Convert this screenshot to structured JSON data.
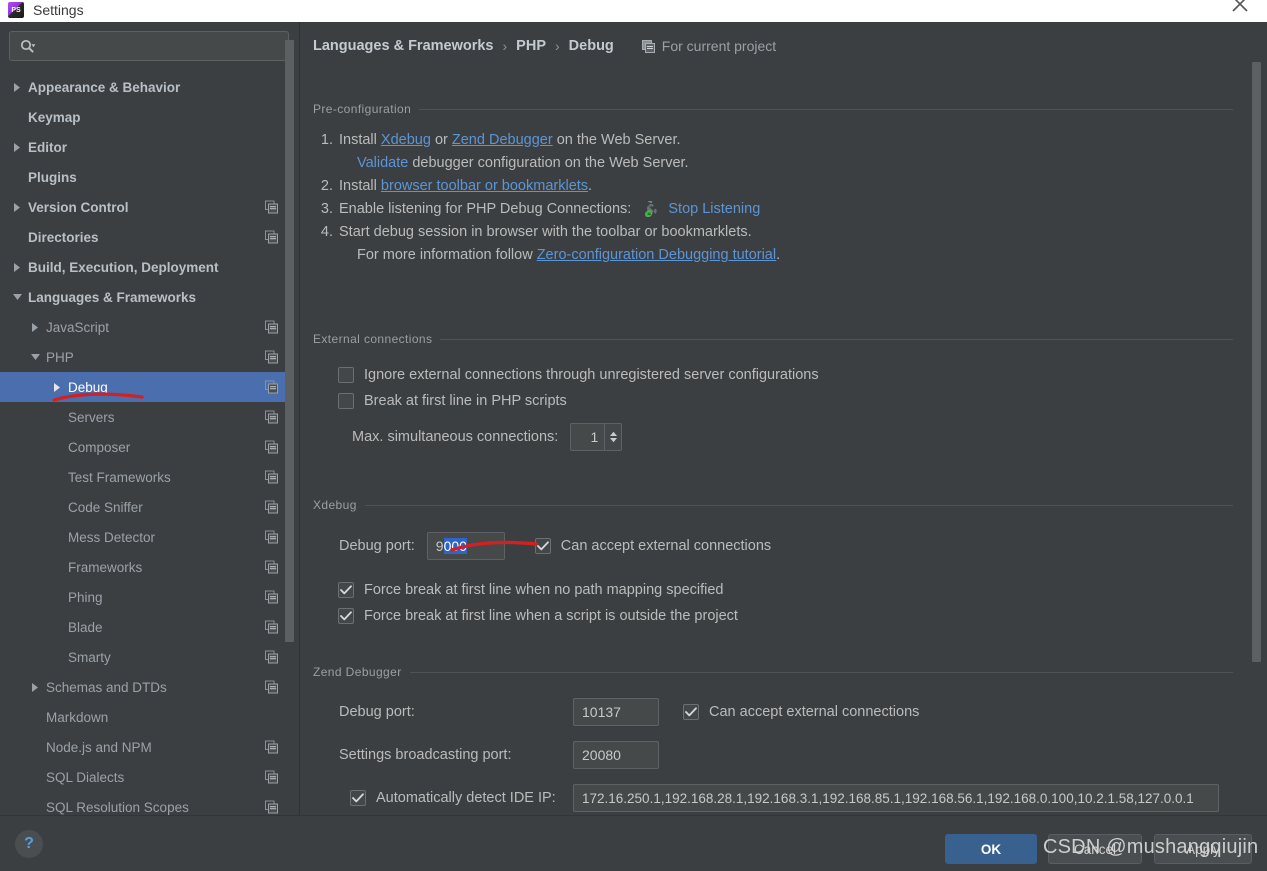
{
  "window": {
    "title": "Settings",
    "app_icon": "phpstorm-icon",
    "close_icon": "close-icon"
  },
  "sidebar": {
    "search": {
      "placeholder": "",
      "value": "",
      "icon": "search-icon",
      "dropdown_icon": "chevron-down-icon"
    },
    "items": [
      {
        "label": "Appearance & Behavior",
        "level": 0,
        "twisty": "collapsed",
        "copy": false,
        "selected": false
      },
      {
        "label": "Keymap",
        "level": 0,
        "twisty": "none",
        "copy": false,
        "selected": false
      },
      {
        "label": "Editor",
        "level": 0,
        "twisty": "collapsed",
        "copy": false,
        "selected": false
      },
      {
        "label": "Plugins",
        "level": 0,
        "twisty": "none",
        "copy": false,
        "selected": false
      },
      {
        "label": "Version Control",
        "level": 0,
        "twisty": "collapsed",
        "copy": true,
        "selected": false
      },
      {
        "label": "Directories",
        "level": 0,
        "twisty": "none",
        "copy": true,
        "selected": false
      },
      {
        "label": "Build, Execution, Deployment",
        "level": 0,
        "twisty": "collapsed",
        "copy": false,
        "selected": false
      },
      {
        "label": "Languages & Frameworks",
        "level": 0,
        "twisty": "expanded",
        "copy": false,
        "selected": false
      },
      {
        "label": "JavaScript",
        "level": 1,
        "twisty": "collapsed",
        "copy": true,
        "selected": false
      },
      {
        "label": "PHP",
        "level": 1,
        "twisty": "expanded",
        "copy": true,
        "selected": false
      },
      {
        "label": "Debug",
        "level": 2,
        "twisty": "collapsed",
        "copy": true,
        "selected": true
      },
      {
        "label": "Servers",
        "level": 2,
        "twisty": "none",
        "copy": true,
        "selected": false
      },
      {
        "label": "Composer",
        "level": 2,
        "twisty": "none",
        "copy": true,
        "selected": false
      },
      {
        "label": "Test Frameworks",
        "level": 2,
        "twisty": "none",
        "copy": true,
        "selected": false
      },
      {
        "label": "Code Sniffer",
        "level": 2,
        "twisty": "none",
        "copy": true,
        "selected": false
      },
      {
        "label": "Mess Detector",
        "level": 2,
        "twisty": "none",
        "copy": true,
        "selected": false
      },
      {
        "label": "Frameworks",
        "level": 2,
        "twisty": "none",
        "copy": true,
        "selected": false
      },
      {
        "label": "Phing",
        "level": 2,
        "twisty": "none",
        "copy": true,
        "selected": false
      },
      {
        "label": "Blade",
        "level": 2,
        "twisty": "none",
        "copy": true,
        "selected": false
      },
      {
        "label": "Smarty",
        "level": 2,
        "twisty": "none",
        "copy": true,
        "selected": false
      },
      {
        "label": "Schemas and DTDs",
        "level": 1,
        "twisty": "collapsed",
        "copy": true,
        "selected": false
      },
      {
        "label": "Markdown",
        "level": 1,
        "twisty": "none",
        "copy": false,
        "selected": false
      },
      {
        "label": "Node.js and NPM",
        "level": 1,
        "twisty": "none",
        "copy": true,
        "selected": false
      },
      {
        "label": "SQL Dialects",
        "level": 1,
        "twisty": "none",
        "copy": true,
        "selected": false
      },
      {
        "label": "SQL Resolution Scopes",
        "level": 1,
        "twisty": "none",
        "copy": true,
        "selected": false
      }
    ]
  },
  "breadcrumb": {
    "segments": [
      "Languages & Frameworks",
      "PHP",
      "Debug"
    ],
    "separator": "›",
    "scope_label": "For current project",
    "scope_icon": "copy-icon"
  },
  "preconfiguration": {
    "title": "Pre-configuration",
    "step1": {
      "num": "1.",
      "install": "Install",
      "xdebug": "Xdebug",
      "or": "or",
      "zend": "Zend Debugger",
      "tail": "on the Web Server."
    },
    "step1_sub": {
      "validate": "Validate",
      "tail": "debugger configuration on the Web Server."
    },
    "step2": {
      "num": "2.",
      "install": "Install",
      "link": "browser toolbar or bookmarklets",
      "tail": "."
    },
    "step3": {
      "num": "3.",
      "text": "Enable listening for PHP Debug Connections:",
      "listen_icon": "phone-listening-icon",
      "listen_link": "Stop Listening"
    },
    "step4": {
      "num": "4.",
      "text": "Start debug session in browser with the toolbar or bookmarklets."
    },
    "step4_sub": {
      "prefix": "For more information follow",
      "link": "Zero-configuration Debugging tutorial",
      "tail": "."
    }
  },
  "external_connections": {
    "title": "External connections",
    "ignore_label": "Ignore external connections through unregistered server configurations",
    "ignore_checked": false,
    "break_label": "Break at first line in PHP scripts",
    "break_checked": false,
    "max_label": "Max. simultaneous connections:",
    "max_value": "1"
  },
  "xdebug": {
    "title": "Xdebug",
    "port_label": "Debug port:",
    "port_value_prefix": "9",
    "port_value_selected": "000",
    "accept_label": "Can accept external connections",
    "accept_checked": true,
    "force_nopath_label": "Force break at first line when no path mapping specified",
    "force_nopath_checked": true,
    "force_outside_label": "Force break at first line when a script is outside the project",
    "force_outside_checked": true
  },
  "zend_debugger": {
    "title": "Zend Debugger",
    "port_label": "Debug port:",
    "port_value": "10137",
    "accept_label": "Can accept external connections",
    "accept_checked": true,
    "broadcast_label": "Settings broadcasting port:",
    "broadcast_value": "20080",
    "autodetect_label": "Automatically detect IDE IP:",
    "autodetect_checked": true,
    "ip_value": "172.16.250.1,192.168.28.1,192.168.3.1,192.168.85.1,192.168.56.1,192.168.0.100,10.2.1.58,127.0.0.1"
  },
  "footer": {
    "help_label": "?",
    "ok_label": "OK",
    "cancel_label": "Cancel",
    "apply_label": "Apply"
  },
  "watermark": {
    "text": "CSDN @mushangqiujin"
  },
  "colors": {
    "accent_blue": "#4b6eaf",
    "link_blue": "#5c95d6",
    "ok_button": "#39618f",
    "selection_blue": "#2f65ca",
    "annotation_red": "#d32020",
    "panel_bg": "#3c3f41",
    "field_bg": "#45494a"
  }
}
